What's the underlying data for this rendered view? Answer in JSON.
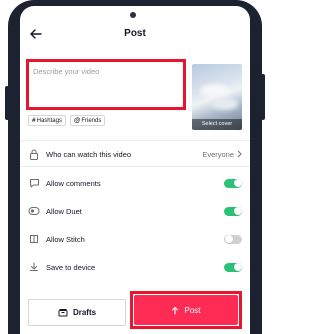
{
  "header": {
    "title": "Post"
  },
  "description": {
    "placeholder": "Describe your video"
  },
  "cover": {
    "label": "Select cover"
  },
  "tags": [
    {
      "symbol": "#",
      "label": "Hashtags",
      "icon": "hash-icon"
    },
    {
      "symbol": "@",
      "label": "Friends",
      "icon": "at-icon"
    }
  ],
  "settings": {
    "who_can_watch": {
      "label": "Who can watch this video",
      "value": "Everyone"
    },
    "allow_comments": {
      "label": "Allow comments",
      "enabled": true
    },
    "allow_duet": {
      "label": "Allow Duet",
      "enabled": true
    },
    "allow_stitch": {
      "label": "Allow Stitch",
      "enabled": false
    },
    "save_to_device": {
      "label": "Save to device",
      "enabled": true
    }
  },
  "actions": {
    "drafts_label": "Drafts",
    "post_label": "Post"
  },
  "colors": {
    "accent": "#fe2c55",
    "highlight": "#e5162d",
    "toggle_on": "#2ac275",
    "toggle_off": "#d0d1d3",
    "device_frame": "#1c2230"
  }
}
